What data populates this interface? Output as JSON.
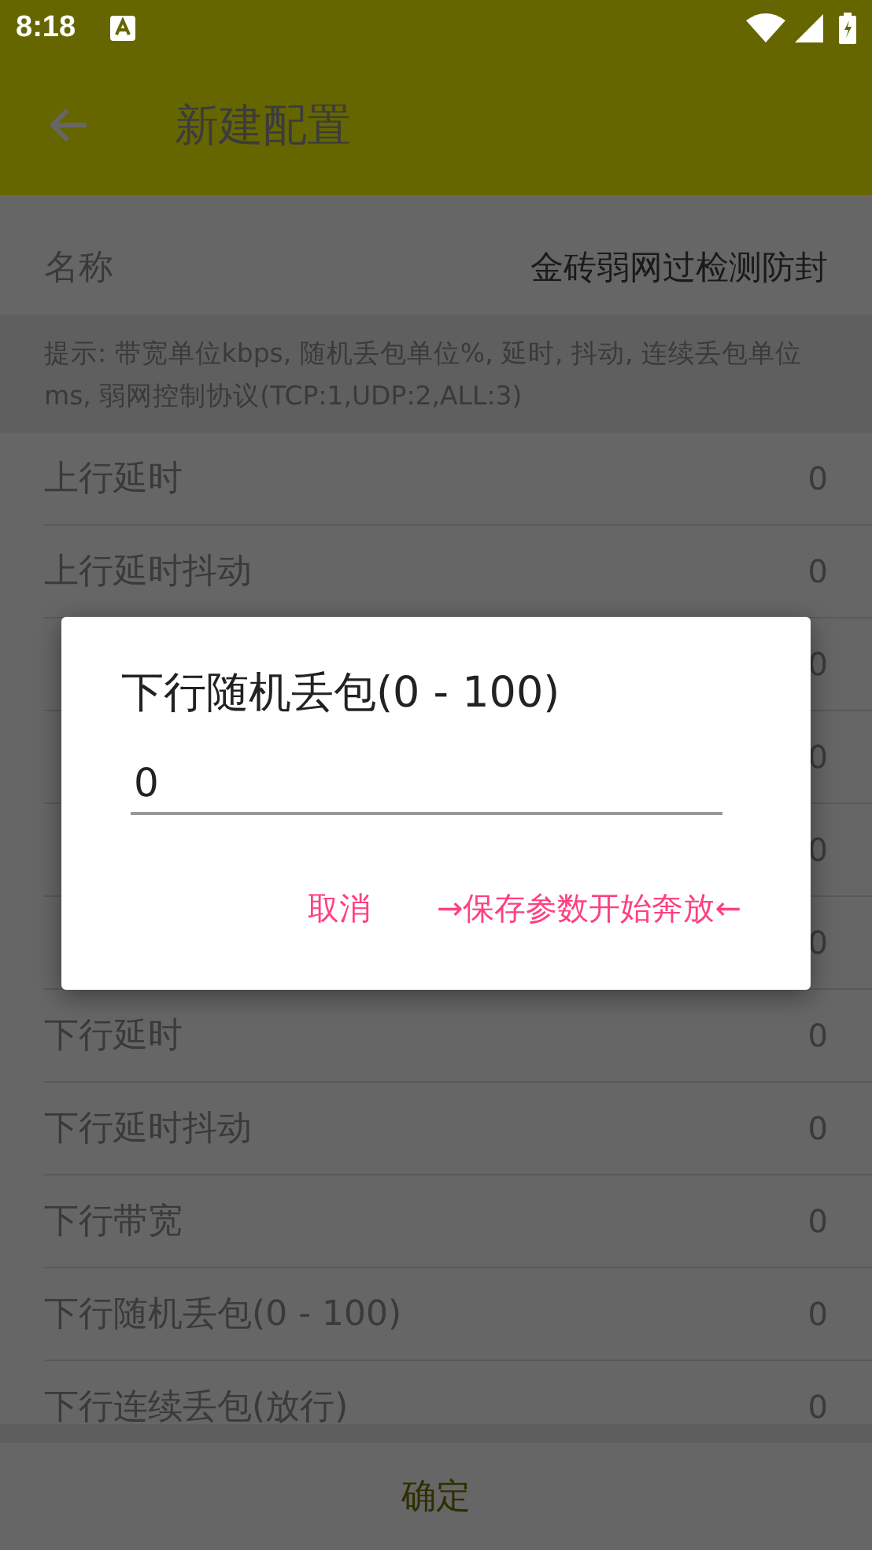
{
  "status_bar": {
    "time": "8:18"
  },
  "app_bar": {
    "title": "新建配置"
  },
  "name_row": {
    "label": "名称",
    "value": "金砖弱网过检测防封"
  },
  "hint": "提示: 带宽单位kbps, 随机丢包单位%, 延时, 抖动, 连续丢包单位ms, 弱网控制协议(TCP:1,UDP:2,ALL:3)",
  "rows": [
    {
      "label": "上行延时",
      "value": "0"
    },
    {
      "label": "上行延时抖动",
      "value": "0"
    },
    {
      "value": "0"
    },
    {
      "value": "0"
    },
    {
      "value": "0"
    },
    {
      "value": "0"
    },
    {
      "label": "下行延时",
      "value": "0"
    },
    {
      "label": "下行延时抖动",
      "value": "0"
    },
    {
      "label": "下行带宽",
      "value": "0"
    },
    {
      "label": "下行随机丢包(0 - 100)",
      "value": "0"
    },
    {
      "label": "下行连续丢包(放行)",
      "value": "0"
    }
  ],
  "dialog": {
    "title": "下行随机丢包(0 - 100)",
    "value": "0",
    "buttons": [
      "取消",
      "→保存参数开始奔放←"
    ]
  },
  "confirm_button": "确定"
}
